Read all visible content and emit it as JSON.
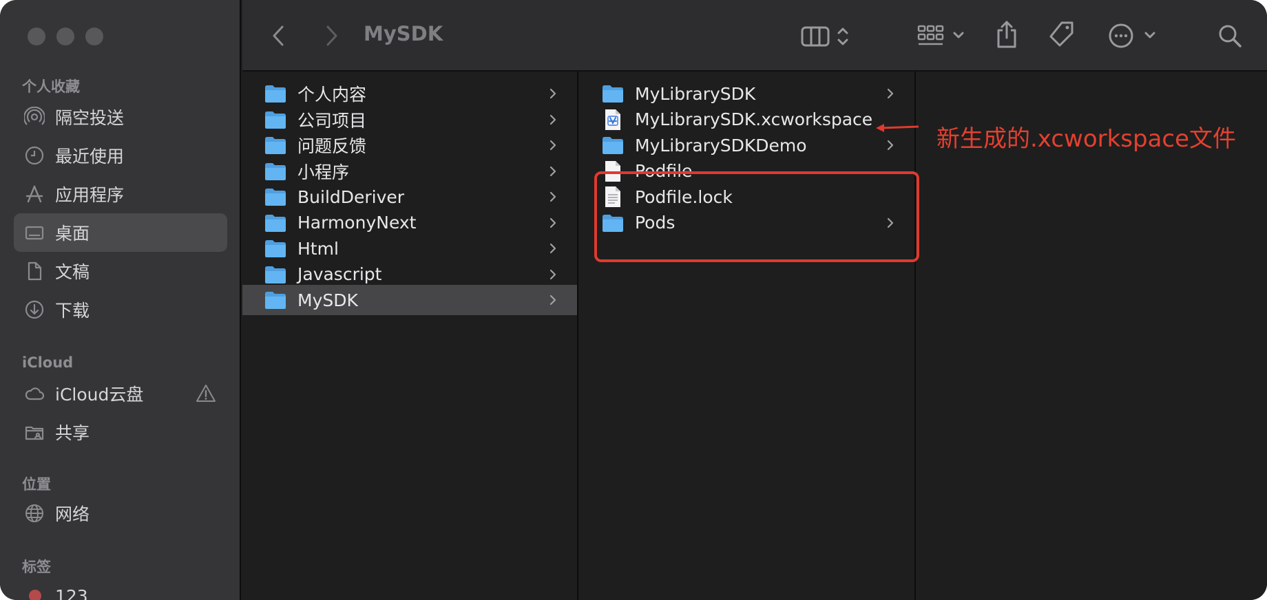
{
  "window": {
    "title": "MySDK"
  },
  "sidebar": {
    "favorites_header": "个人收藏",
    "favorites": [
      {
        "label": "隔空投送",
        "icon": "airdrop-icon"
      },
      {
        "label": "最近使用",
        "icon": "clock-icon"
      },
      {
        "label": "应用程序",
        "icon": "applications-icon"
      },
      {
        "label": "桌面",
        "icon": "desktop-icon",
        "selected": true
      },
      {
        "label": "文稿",
        "icon": "document-icon"
      },
      {
        "label": "下载",
        "icon": "download-icon"
      }
    ],
    "icloud_header": "iCloud",
    "icloud": [
      {
        "label": "iCloud云盘",
        "icon": "cloud-icon",
        "warning": true
      },
      {
        "label": "共享",
        "icon": "shared-folder-icon"
      }
    ],
    "locations_header": "位置",
    "locations": [
      {
        "label": "网络",
        "icon": "globe-icon"
      }
    ],
    "tags_header": "标签",
    "tags": [
      {
        "label": "123",
        "color": "#b44a4a"
      }
    ]
  },
  "toolbar": {
    "back_icon": "chevron-left-icon",
    "forward_icon": "chevron-right-icon",
    "view_icon": "column-view-icon",
    "group_icon": "grid-group-icon",
    "share_icon": "share-icon",
    "tag_icon": "tag-icon",
    "more_icon": "ellipsis-circle-icon",
    "search_icon": "search-icon"
  },
  "column1": [
    {
      "name": "个人内容",
      "type": "folder"
    },
    {
      "name": "公司项目",
      "type": "folder"
    },
    {
      "name": "问题反馈",
      "type": "folder"
    },
    {
      "name": "小程序",
      "type": "folder"
    },
    {
      "name": "BuildDeriver",
      "type": "folder"
    },
    {
      "name": "HarmonyNext",
      "type": "folder"
    },
    {
      "name": "Html",
      "type": "folder"
    },
    {
      "name": "Javascript",
      "type": "folder"
    },
    {
      "name": "MySDK",
      "type": "folder",
      "selected": true
    }
  ],
  "column2": [
    {
      "name": "MyLibrarySDK",
      "type": "folder"
    },
    {
      "name": "MyLibrarySDK.xcworkspace",
      "type": "workspace"
    },
    {
      "name": "MyLibrarySDKDemo",
      "type": "folder"
    },
    {
      "name": "Podfile",
      "type": "file"
    },
    {
      "name": "Podfile.lock",
      "type": "textfile"
    },
    {
      "name": "Pods",
      "type": "folder"
    }
  ],
  "annotation": {
    "text": "新生成的.xcworkspace文件",
    "color": "#e03a2e"
  },
  "colors": {
    "sidebar_bg": "#353437",
    "content_bg": "#1e1e1e",
    "folder_blue": "#5fb4f0",
    "selection": "#464648"
  }
}
